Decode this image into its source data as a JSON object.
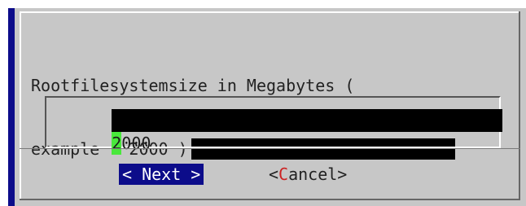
{
  "dialog": {
    "prompt_line1": "Rootfilesystemsize in Megabytes (",
    "prompt_line2": "example : 2000 )"
  },
  "input": {
    "cursor_char": "2",
    "rest_value": "000"
  },
  "buttons": {
    "next_label": "< Next >",
    "cancel_open": "<",
    "cancel_hotkey": "C",
    "cancel_rest": "ancel>"
  },
  "colors": {
    "dialog_bg": "#c7c7c7",
    "accent": "#0c0c8a",
    "cursor": "#49e83c",
    "hotkey": "#cc2222"
  }
}
